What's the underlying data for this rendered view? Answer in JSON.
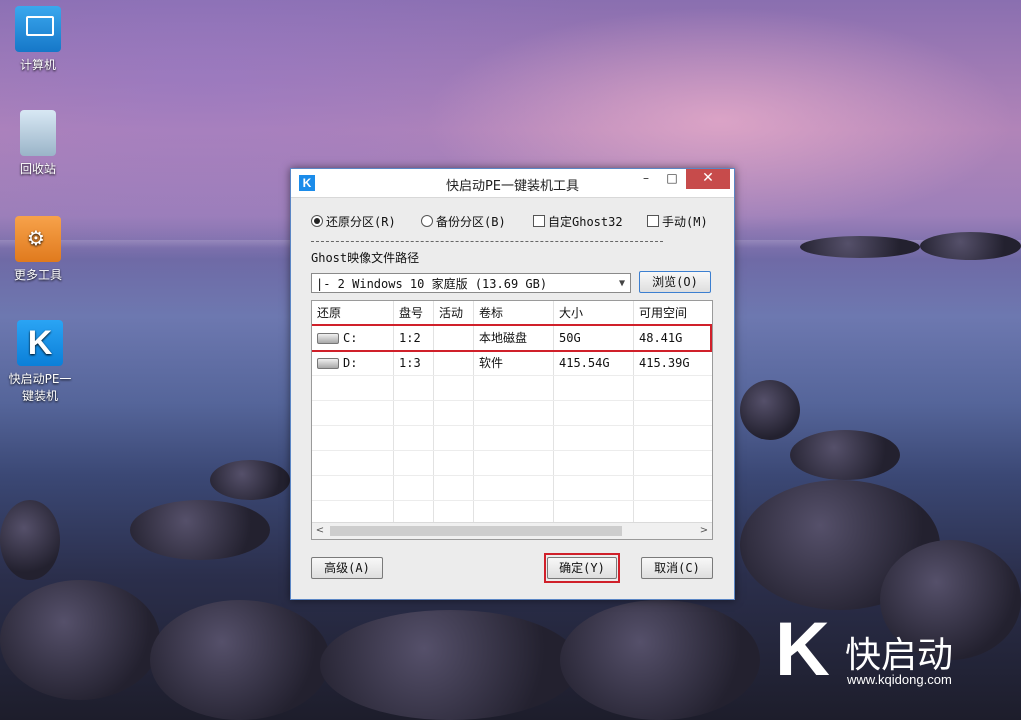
{
  "desktop": {
    "icons": [
      {
        "label": "计算机"
      },
      {
        "label": "回收站"
      },
      {
        "label": "更多工具"
      },
      {
        "label": "快启动PE一键装机"
      }
    ]
  },
  "window": {
    "logo_letter": "K",
    "title": "快启动PE一键装机工具",
    "controls": {
      "minimize": "–",
      "maximize": "□",
      "close": "✕"
    },
    "options": {
      "restore": "还原分区(R)",
      "backup": "备份分区(B)",
      "custom_ghost": "自定Ghost32",
      "manual": "手动(M)",
      "selected": "restore"
    },
    "path_label": "Ghost映像文件路径",
    "image_select": {
      "value": "|- 2 Windows 10 家庭版 (13.69 GB)"
    },
    "browse_label": "浏览(O)",
    "table": {
      "headers": [
        "还原",
        "盘号",
        "活动",
        "卷标",
        "大小",
        "可用空间"
      ],
      "rows": [
        {
          "drive": "C:",
          "disk": "1:2",
          "active": "",
          "label": "本地磁盘",
          "size": "50G",
          "free": "48.41G"
        },
        {
          "drive": "D:",
          "disk": "1:3",
          "active": "",
          "label": "软件",
          "size": "415.54G",
          "free": "415.39G"
        }
      ],
      "scroll_left": "<",
      "scroll_right": ">"
    },
    "buttons": {
      "advanced": "高级(A)",
      "ok": "确定(Y)",
      "cancel": "取消(C)"
    }
  },
  "brand": {
    "letter": "K",
    "name": "快启动",
    "url": "www.kqidong.com"
  },
  "colors": {
    "accent": "#1b8cea",
    "highlight": "#d0202a",
    "close": "#c74b4b"
  }
}
